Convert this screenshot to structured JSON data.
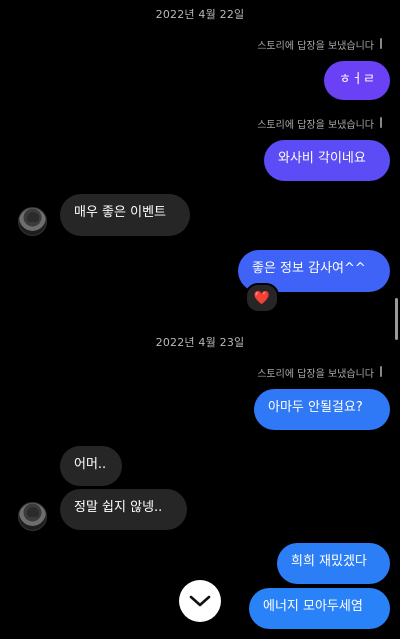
{
  "dates": {
    "d1": "2022년 4월 22일",
    "d2": "2022년 4월 23일"
  },
  "story_reply_note": "스토리에 답장을 보냈습니다",
  "messages": {
    "m1": "ㅎㅓㄹ",
    "m2": "와사비 각이네요",
    "m3": "매우 좋은 이벤트",
    "m4": "좋은 정보 감사여^^",
    "m5": "아마두 안될걸요?",
    "m6": "어머..",
    "m7": "정말 쉽지 않넹..",
    "m8": "희희 재밌겠다",
    "m9": "에너지 모아두세염"
  },
  "reaction_emoji": "❤️",
  "colors": {
    "out_gradient_top": "#6c3ff5",
    "out_gradient_bottom": "#2f7bf7",
    "incoming": "#262626",
    "background": "#000000"
  },
  "icons": {
    "avatar": "profile-avatar",
    "scroll_down": "chevron-down-icon"
  }
}
